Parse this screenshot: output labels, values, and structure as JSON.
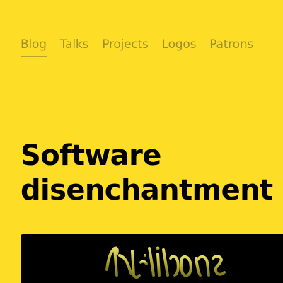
{
  "nav": {
    "items": [
      {
        "label": "Blog",
        "active": true
      },
      {
        "label": "Talks",
        "active": false
      },
      {
        "label": "Projects",
        "active": false
      },
      {
        "label": "Logos",
        "active": false
      },
      {
        "label": "Patrons",
        "active": false
      }
    ]
  },
  "article": {
    "title_line1": "Software",
    "title_line2": "disenchantment",
    "hero_image_icon": "gothic-lettering-image"
  },
  "colors": {
    "background": "#FDDD25",
    "nav_text": "#9D8F2C",
    "title_text": "#000000",
    "hero_background": "#000000",
    "hero_lettering": "#C9C24A"
  }
}
